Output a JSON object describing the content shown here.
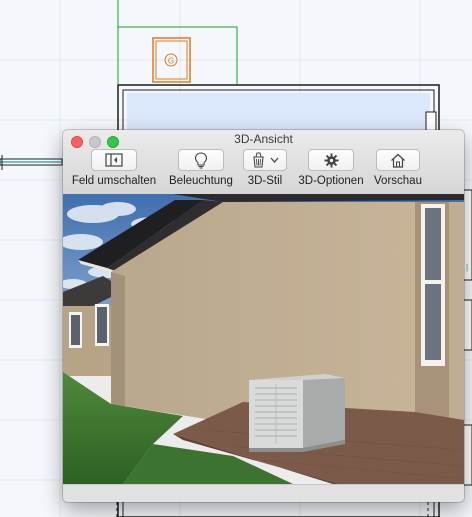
{
  "window": {
    "title": "3D-Ansicht"
  },
  "toolbar": {
    "items": [
      {
        "label": "Feld umschalten",
        "icon": "toggle-panel-icon"
      },
      {
        "label": "Beleuchtung",
        "icon": "lightbulb-icon"
      },
      {
        "label": "3D-Stil",
        "icon": "paint-bucket-icon"
      },
      {
        "label": "3D-Optionen",
        "icon": "gear-icon"
      },
      {
        "label": "Vorschau",
        "icon": "house-icon"
      }
    ]
  },
  "plan": {
    "symbol": "G"
  },
  "colors": {
    "plan_outline": "#13a024",
    "plan_wall": "#1d1d1d",
    "symbol": "#e07a1a",
    "close": "#fc605b",
    "maximize": "#34c749"
  }
}
